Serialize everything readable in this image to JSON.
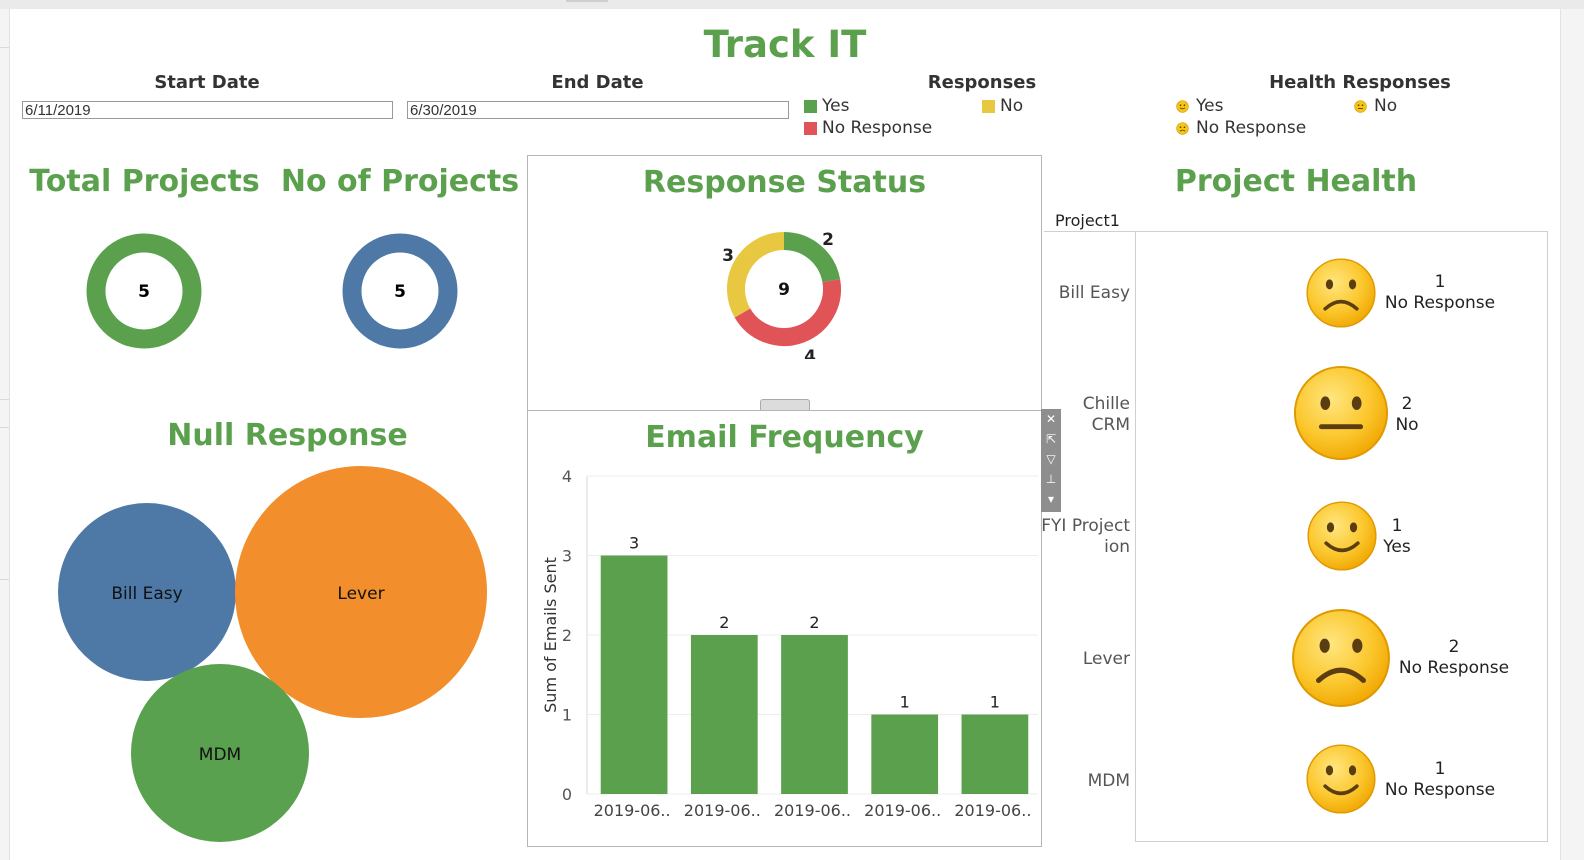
{
  "title": "Track IT",
  "filters": {
    "start_date_label": "Start Date",
    "start_date_value": "6/11/2019",
    "end_date_label": "End Date",
    "end_date_value": "6/30/2019"
  },
  "responses_legend": {
    "title": "Responses",
    "items": [
      {
        "label": "Yes",
        "color": "#5ba14d"
      },
      {
        "label": "No",
        "color": "#e8c840"
      },
      {
        "label": "No Response",
        "color": "#e05458"
      }
    ]
  },
  "health_legend": {
    "title": "Health Responses",
    "items": [
      {
        "label": "Yes",
        "icon": "smile-face-icon"
      },
      {
        "label": "No",
        "icon": "neutral-face-icon"
      },
      {
        "label": "No Response",
        "icon": "sad-face-icon"
      }
    ]
  },
  "total_projects": {
    "title": "Total Projects",
    "value": "5",
    "color": "#5ba14d"
  },
  "no_of_projects": {
    "title": "No of Projects",
    "value": "5",
    "color": "#4e79a7"
  },
  "response_status": {
    "title": "Response Status",
    "total": "9",
    "segments": [
      {
        "label": "2",
        "value": 2,
        "color": "#5ba14d"
      },
      {
        "label": "4",
        "value": 4,
        "color": "#e05458"
      },
      {
        "label": "3",
        "value": 3,
        "color": "#e8c840"
      }
    ]
  },
  "null_response": {
    "title": "Null Response",
    "bubbles": [
      {
        "label": "Bill Easy",
        "color": "#4e79a7"
      },
      {
        "label": "Lever",
        "color": "#f28e2b"
      },
      {
        "label": "MDM",
        "color": "#59a14f"
      }
    ]
  },
  "email_frequency": {
    "title": "Email Frequency"
  },
  "chart_data": {
    "type": "bar",
    "title": "Email Frequency",
    "xlabel": "",
    "ylabel": "Sum of Emails Sent",
    "categories": [
      "2019-06..",
      "2019-06..",
      "2019-06..",
      "2019-06..",
      "2019-06.."
    ],
    "values": [
      3,
      2,
      2,
      1,
      1
    ],
    "ylim": [
      0,
      4
    ],
    "yticks": [
      0,
      1,
      2,
      3,
      4
    ],
    "bar_color": "#5ba14d",
    "grid": true
  },
  "project_health": {
    "title": "Project Health",
    "column_header": "Project1",
    "rows": [
      {
        "name": "Bill Easy",
        "count": "1",
        "status": "No Response",
        "face": "sad-face-icon"
      },
      {
        "name": "Chille CRM",
        "count": "2",
        "status": "No",
        "face": "neutral-face-icon"
      },
      {
        "name": "FYI Projection",
        "count": "1",
        "status": "Yes",
        "face": "smile-face-icon"
      },
      {
        "name": "Lever",
        "count": "2",
        "status": "No Response",
        "face": "sad-face-icon"
      },
      {
        "name": "MDM",
        "count": "1",
        "status": "No Response",
        "face": "smile-face-icon"
      }
    ]
  }
}
